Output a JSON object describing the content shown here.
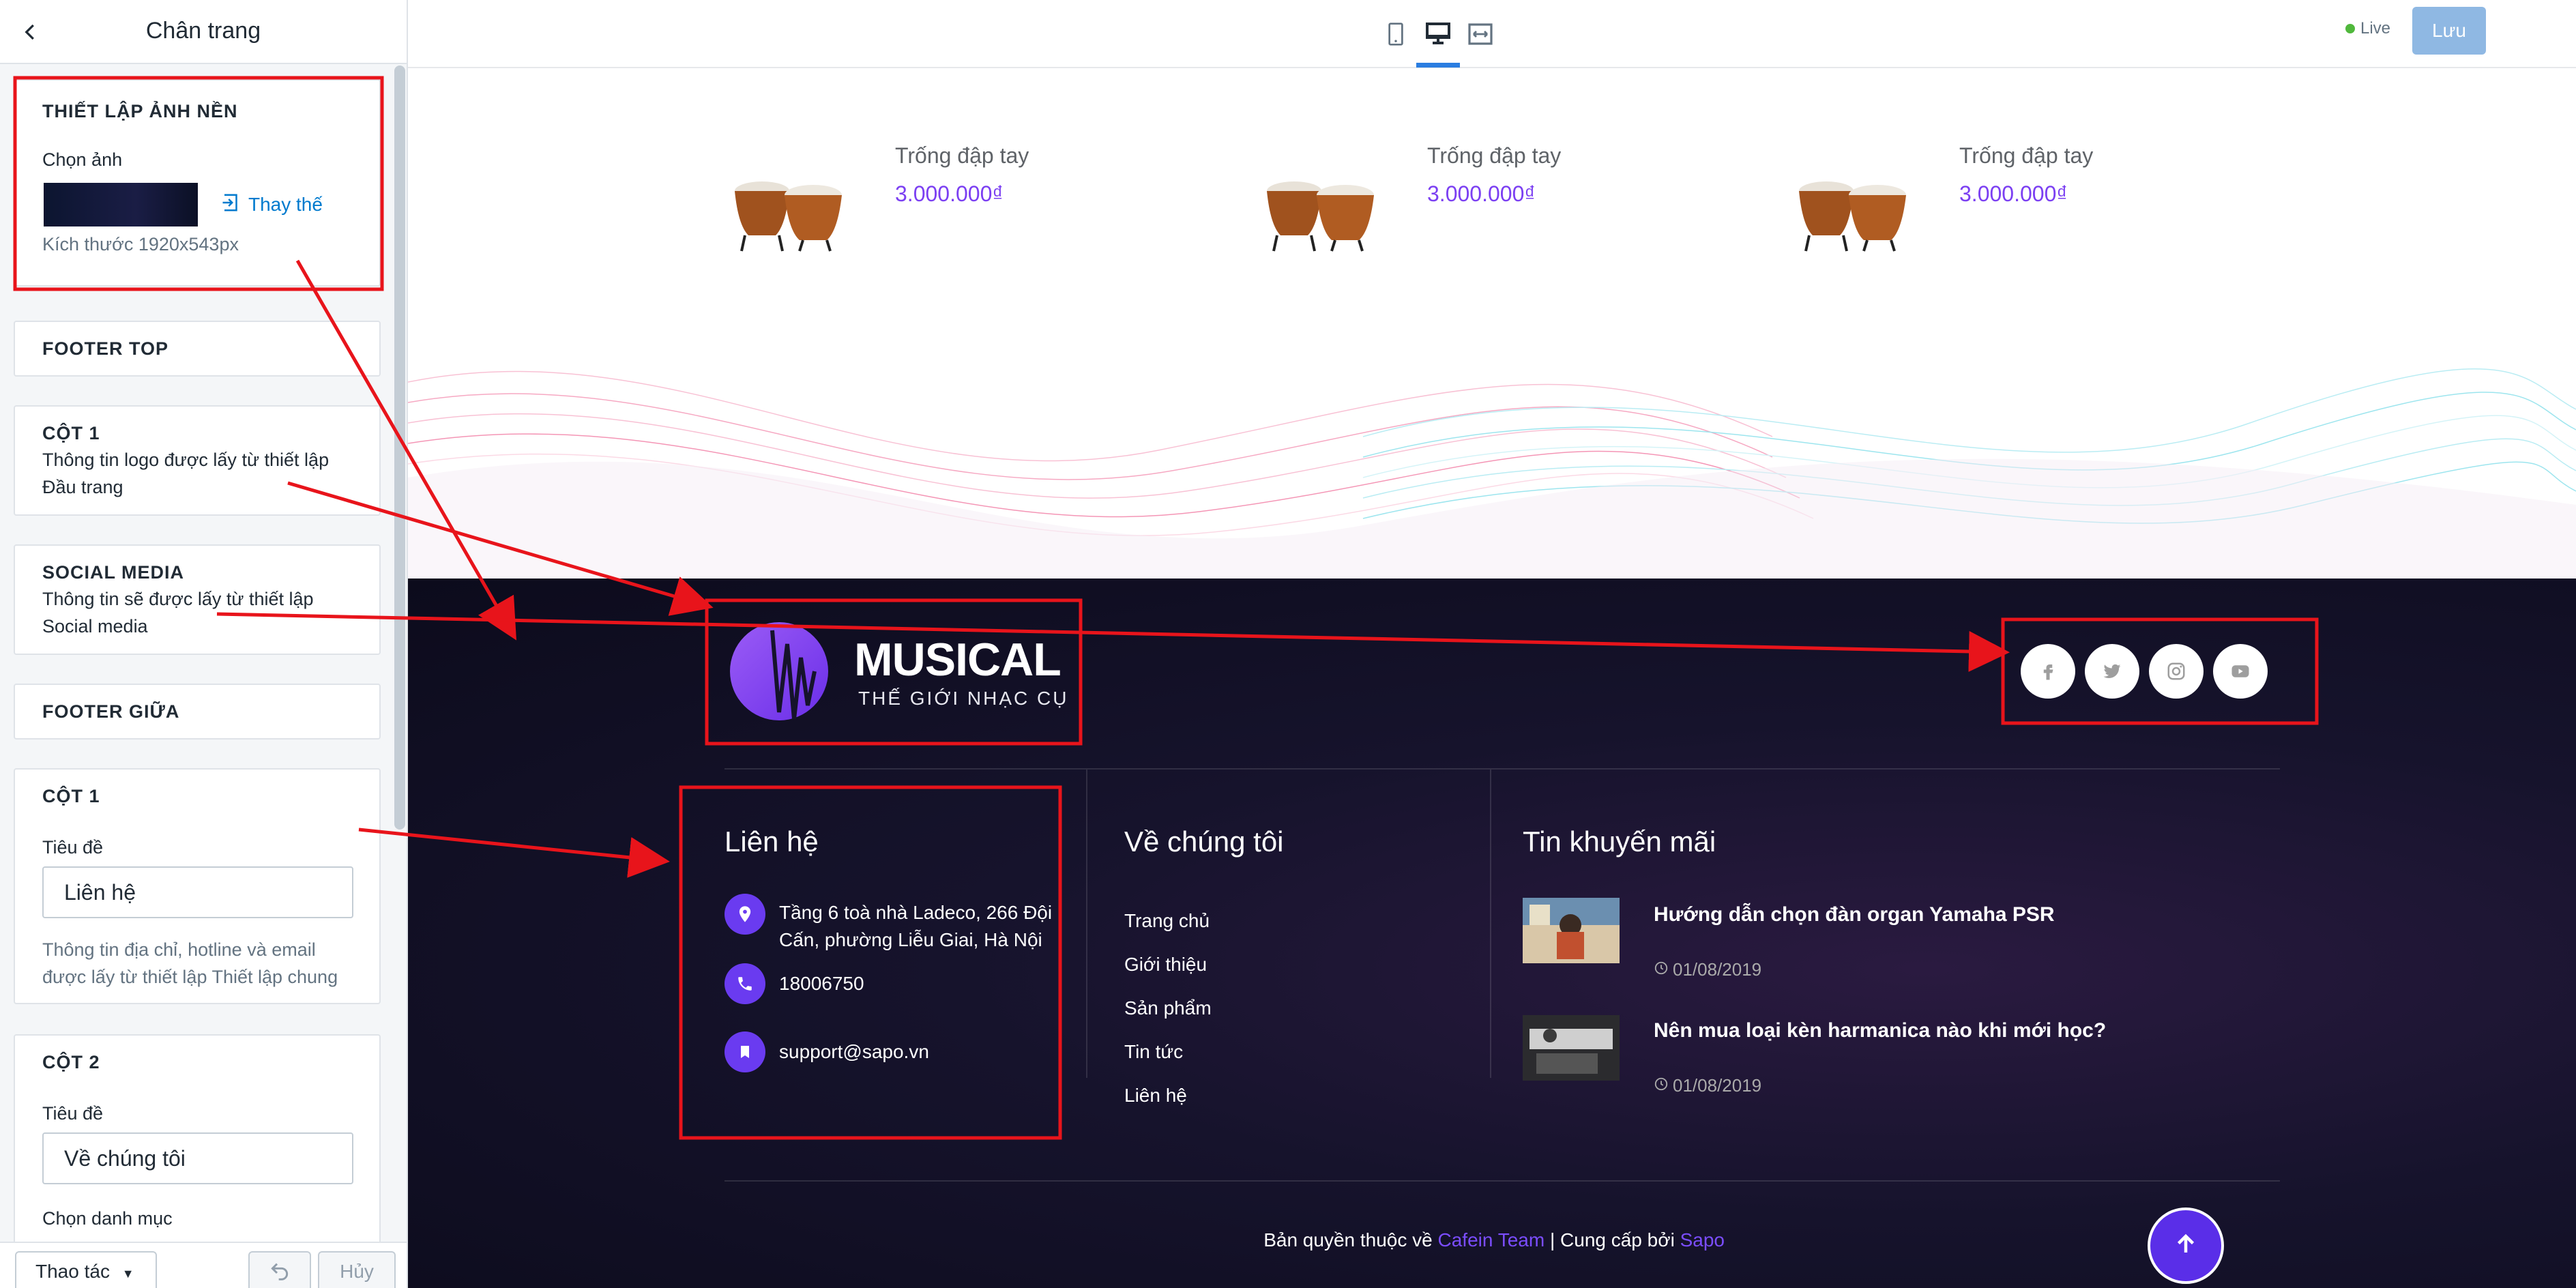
{
  "sidebar": {
    "title": "Chân trang",
    "bg_section": {
      "heading": "THIẾT LẬP ẢNH NỀN",
      "choose_label": "Chọn ảnh",
      "replace_label": "Thay thế",
      "size_text": "Kích thước 1920x543px"
    },
    "footer_top": {
      "heading": "FOOTER TOP"
    },
    "col1_top": {
      "heading": "CỘT 1",
      "desc": [
        "Thông tin logo được lấy từ thiết lập",
        "Đầu trang"
      ]
    },
    "social_media": {
      "heading": "SOCIAL MEDIA",
      "desc": [
        "Thông tin sẽ được lấy từ thiết lập",
        "Social media"
      ]
    },
    "footer_mid": {
      "heading": "FOOTER GIỮA"
    },
    "col1_mid": {
      "heading": "CỘT 1",
      "title_label": "Tiêu đề",
      "title_value": "Liên hệ",
      "desc": [
        "Thông tin địa chỉ, hotline và email",
        "được lấy từ thiết lập Thiết lập chung"
      ]
    },
    "col2_mid": {
      "heading": "CỘT 2",
      "title_label": "Tiêu đề",
      "title_value": "Về chúng tôi",
      "category_label": "Chọn danh mục"
    },
    "actions_label": "Thao tác",
    "cancel_label": "Hủy"
  },
  "toolbar": {
    "live_label": "Live",
    "save_label": "Lưu",
    "devices": [
      "mobile-icon",
      "desktop-icon",
      "fullwidth-icon"
    ]
  },
  "products": [
    {
      "name": "Trống đập tay",
      "price": "3.000.000₫"
    },
    {
      "name": "Trống đập tay",
      "price": "3.000.000₫"
    },
    {
      "name": "Trống đập tay",
      "price": "3.000.000₫"
    }
  ],
  "footer": {
    "logo_title": "MUSICAL",
    "logo_subtitle": "THẾ GIỚI NHẠC CỤ",
    "socials": [
      "facebook-icon",
      "twitter-icon",
      "instagram-icon",
      "youtube-icon"
    ],
    "contact": {
      "heading": "Liên hệ",
      "address": [
        "Tầng 6 toà nhà Ladeco, 266 Đội",
        "Cấn, phường Liễu Giai, Hà Nội"
      ],
      "phone": "18006750",
      "email": "support@sapo.vn"
    },
    "about": {
      "heading": "Về chúng tôi",
      "links": [
        "Trang chủ",
        "Giới thiệu",
        "Sản phẩm",
        "Tin tức",
        "Liên hệ"
      ]
    },
    "promo": {
      "heading": "Tin khuyến mãi",
      "items": [
        {
          "title": "Hướng dẫn chọn đàn organ Yamaha PSR",
          "date": "01/08/2019"
        },
        {
          "title": "Nên mua loại kèn harmanica nào khi mới học?",
          "date": "01/08/2019"
        }
      ]
    },
    "copyright": {
      "prefix": "Bản quyền thuộc về ",
      "team": "Cafein Team",
      "sep": " | Cung cấp bởi ",
      "provider": "Sapo"
    }
  },
  "colors": {
    "accent": "#7b3ff2",
    "annotation": "#e8141b",
    "save": "#8fb8e3",
    "footer_bg": "#16132c"
  }
}
